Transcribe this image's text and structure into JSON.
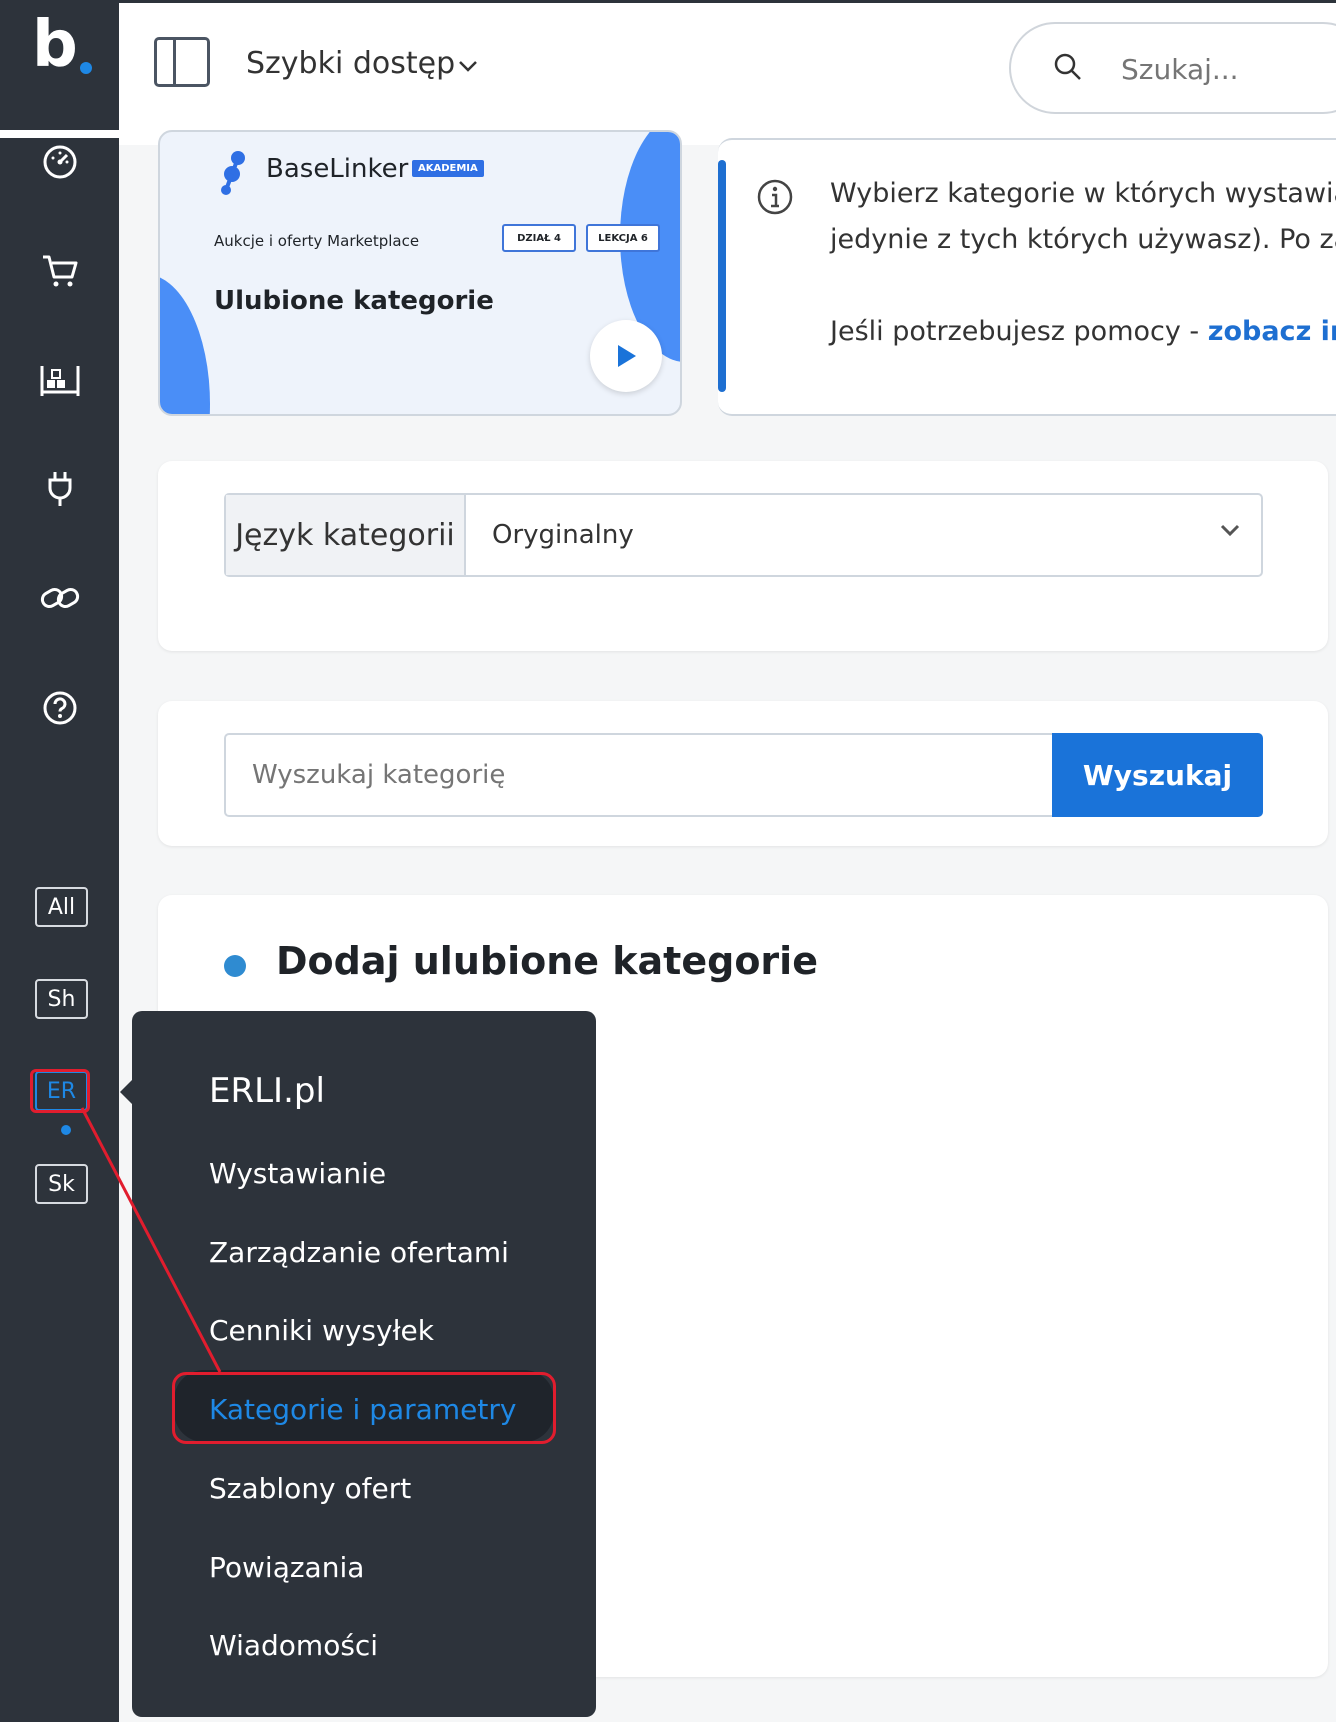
{
  "logo": {
    "letter": "b"
  },
  "header": {
    "quick_access_label": "Szybki dostęp",
    "search_placeholder": "Szukaj..."
  },
  "video_card": {
    "brand": "BaseLinker",
    "badge": "AKADEMIA",
    "subtitle": "Aukcje i oferty Marketplace",
    "tag_section": "DZIAŁ 4",
    "tag_lesson": "LEKCJA 6",
    "title": "Ulubione kategorie",
    "accent_color": "#4a8ef7"
  },
  "info": {
    "line1": "Wybierz kategorie w których wystawias",
    "line2": "jedynie z tych których używasz). Po zap",
    "line3_prefix": "Jeśli potrzebujesz pomocy - ",
    "line3_link": "zobacz ins"
  },
  "language": {
    "label": "Język kategorii",
    "selected": "Oryginalny"
  },
  "category_search": {
    "placeholder": "Wyszukaj kategorię",
    "button": "Wyszukaj"
  },
  "favorites": {
    "title": "Dodaj ulubione kategorie"
  },
  "sidebar": {
    "icons": [
      "dashboard-icon",
      "cart-icon",
      "warehouse-icon",
      "plug-icon",
      "link-icon",
      "help-icon"
    ],
    "badges": [
      "All",
      "Sh",
      "ER",
      "Sk"
    ],
    "active_badge": "ER",
    "accent_color": "#1e88e5"
  },
  "flyout": {
    "title": "ERLI.pl",
    "items": [
      "Wystawianie",
      "Zarządzanie ofertami",
      "Cenniki wysyłek",
      "Kategorie i parametry",
      "Szablony ofert",
      "Powiązania",
      "Wiadomości"
    ],
    "active_item": "Kategorie i parametry"
  },
  "annotation_color": "#e11d2e"
}
